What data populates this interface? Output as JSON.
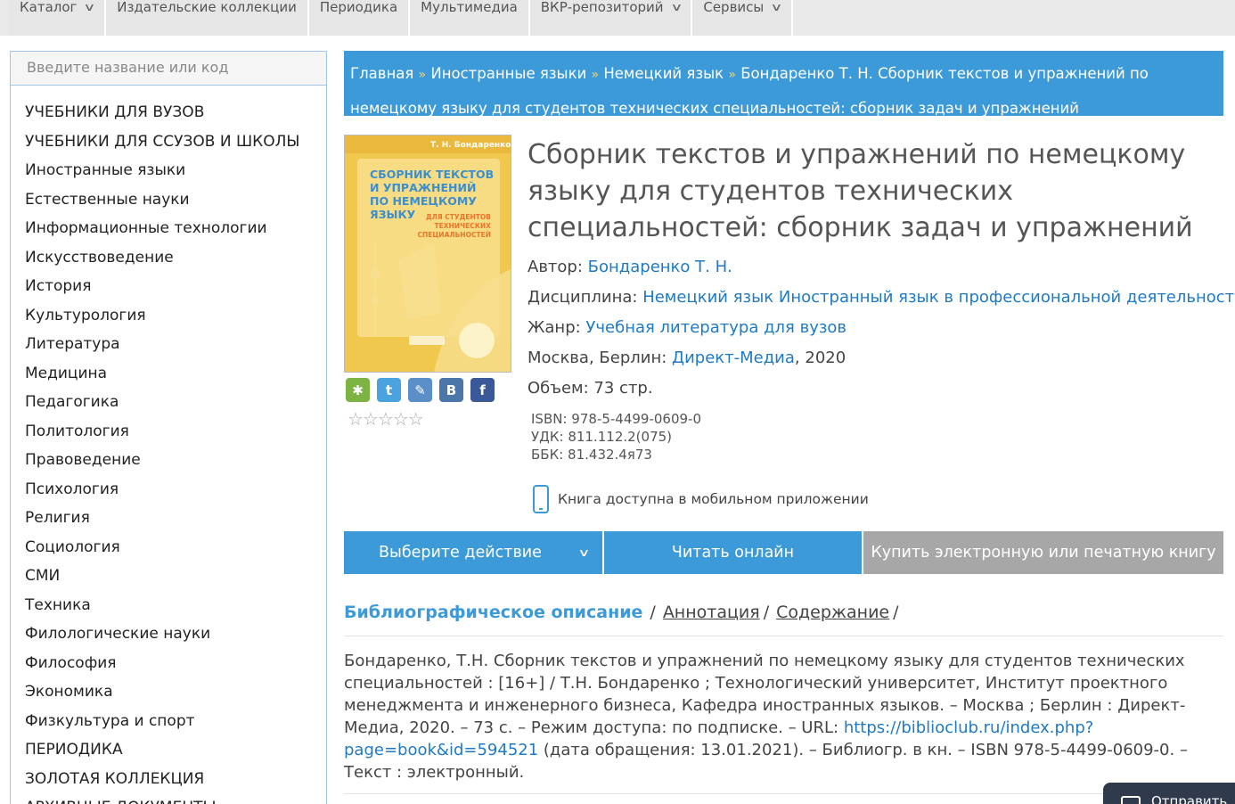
{
  "nav": {
    "items": [
      {
        "label": "Каталог",
        "has_dropdown": true
      },
      {
        "label": "Издательские коллекции",
        "has_dropdown": false
      },
      {
        "label": "Периодика",
        "has_dropdown": false
      },
      {
        "label": "Мультимедиа",
        "has_dropdown": false
      },
      {
        "label": "ВКР-репозиторий",
        "has_dropdown": true
      },
      {
        "label": "Сервисы",
        "has_dropdown": true
      }
    ]
  },
  "sidebar": {
    "search_placeholder": "Введите название или код",
    "categories": [
      "УЧЕБНИКИ ДЛЯ ВУЗОВ",
      "УЧЕБНИКИ ДЛЯ ССУЗОВ И ШКОЛЫ",
      "Иностранные языки",
      "Естественные науки",
      "Информационные технологии",
      "Искусствоведение",
      "История",
      "Культурология",
      "Литература",
      "Медицина",
      "Педагогика",
      "Политология",
      "Правоведение",
      "Психология",
      "Религия",
      "Социология",
      "СМИ",
      "Техника",
      "Филологические науки",
      "Философия",
      "Экономика",
      "Физкультура и спорт",
      "ПЕРИОДИКА",
      "ЗОЛОТАЯ КОЛЛЕКЦИЯ",
      "АРХИВНЫЕ ДОКУМЕНТЫ"
    ]
  },
  "breadcrumb": {
    "items": [
      "Главная",
      "Иностранные языки",
      "Немецкий язык",
      "Бондаренко Т. Н. Сборник текстов и упражнений по немецкому языку для студентов технических специальностей: сборник задач и упражнений"
    ],
    "separator": "»"
  },
  "cover": {
    "author": "Т. Н. Бондаренко",
    "title_lines": [
      "СБОРНИК ТЕКСТОВ",
      "И УПРАЖНЕНИЙ",
      "ПО НЕМЕЦКОМУ"
    ],
    "title_tail": "ЯЗЫКУ",
    "subtitle_lines": [
      "ДЛЯ СТУДЕНТОВ",
      "ТЕХНИЧЕСКИХ",
      "СПЕЦИАЛЬНОСТЕЙ"
    ],
    "colors": {
      "bg": "#f1c84e",
      "accent": "#3a8fd0",
      "orange": "#e8752a"
    }
  },
  "share": [
    {
      "name": "odnoklassniki",
      "glyph": "✱",
      "color": "#7cb342"
    },
    {
      "name": "twitter",
      "glyph": "t",
      "color": "#4aa3df"
    },
    {
      "name": "livejournal",
      "glyph": "✎",
      "color": "#5b8fc7"
    },
    {
      "name": "vkontakte",
      "glyph": "B",
      "color": "#4a76a8"
    },
    {
      "name": "facebook",
      "glyph": "f",
      "color": "#3b5998"
    }
  ],
  "rating": {
    "value": 0,
    "max": 5
  },
  "book": {
    "title": "Сборник текстов и упражнений по немецкому языку для студентов технических специальностей: сборник задач и упражнений",
    "author_label": "Автор:",
    "author": "Бондаренко Т. Н.",
    "discipline_label": "Дисциплина:",
    "discipline": "Немецкий язык Иностранный язык в профессиональной деятельности",
    "genre_label": "Жанр:",
    "genre": "Учебная литература для вузов",
    "place": "Москва, Берлин:",
    "publisher": "Директ-Медиа",
    "year": ", 2020",
    "volume": "Объем: 73 стр.",
    "isbn": "ISBN: 978-5-4499-0609-0",
    "udk": "УДК: 811.112.2(075)",
    "bbk": "ББК: 81.432.4я73",
    "mobile_note": "Книга доступна в мобильном приложении"
  },
  "actions": {
    "choose": "Выберите действие",
    "read": "Читать онлайн",
    "buy": "Купить электронную или печатную книгу"
  },
  "tabs": {
    "active": "Библиографическое описание",
    "annotation": "Аннотация",
    "contents": "Содержание"
  },
  "biblio": {
    "text_before": "Бондаренко, Т.Н. Сборник текстов и упражнений по немецкому языку для студентов технических специальностей : [16+] / Т.Н. Бондаренко ; Технологический университет, Институт проектного менеджмента и инженерного бизнеса, Кафедра иностранных языков. – Москва ; Берлин : Директ-Медиа, 2020. – 73 с. – Режим доступа: по подписке. – URL: ",
    "url": "https://biblioclub.ru/index.php?page=book&id=594521",
    "text_after": " (дата обращения: 13.01.2021). – Библиогр. в кн. – ISBN 978-5-4499-0609-0. – Текст : электронный."
  },
  "widget": {
    "label": "Отправить"
  }
}
